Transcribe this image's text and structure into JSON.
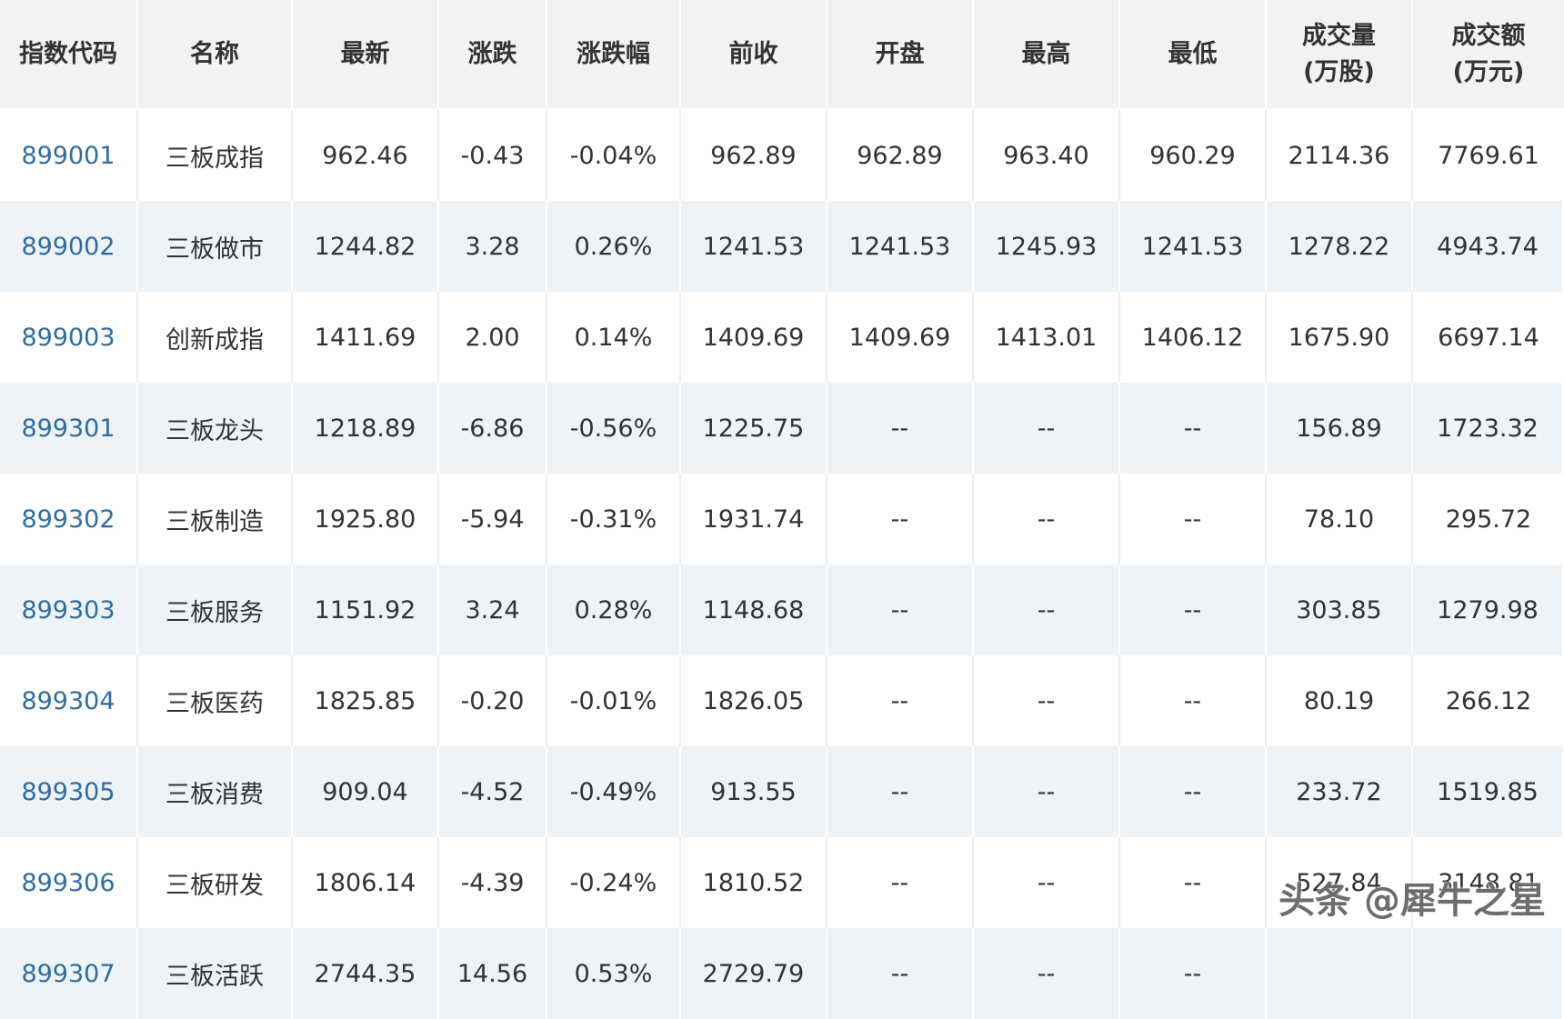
{
  "table": {
    "headers": [
      "指数代码",
      "名称",
      "最新",
      "涨跌",
      "涨跌幅",
      "前收",
      "开盘",
      "最高",
      "最低"
    ],
    "header_volume_line1": "成交量",
    "header_volume_line2": "(万股)",
    "header_amount_line1": "成交额",
    "header_amount_line2": "(万元)",
    "rows": [
      {
        "code": "899001",
        "name": "三板成指",
        "latest": "962.46",
        "change": "-0.43",
        "change_pct": "-0.04%",
        "prev_close": "962.89",
        "open": "962.89",
        "high": "963.40",
        "low": "960.29",
        "volume": "2114.36",
        "amount": "7769.61",
        "direction": "down"
      },
      {
        "code": "899002",
        "name": "三板做市",
        "latest": "1244.82",
        "change": "3.28",
        "change_pct": "0.26%",
        "prev_close": "1241.53",
        "open": "1241.53",
        "high": "1245.93",
        "low": "1241.53",
        "volume": "1278.22",
        "amount": "4943.74",
        "direction": "up"
      },
      {
        "code": "899003",
        "name": "创新成指",
        "latest": "1411.69",
        "change": "2.00",
        "change_pct": "0.14%",
        "prev_close": "1409.69",
        "open": "1409.69",
        "high": "1413.01",
        "low": "1406.12",
        "volume": "1675.90",
        "amount": "6697.14",
        "direction": "up"
      },
      {
        "code": "899301",
        "name": "三板龙头",
        "latest": "1218.89",
        "change": "-6.86",
        "change_pct": "-0.56%",
        "prev_close": "1225.75",
        "open": "--",
        "high": "--",
        "low": "--",
        "volume": "156.89",
        "amount": "1723.32",
        "direction": "down"
      },
      {
        "code": "899302",
        "name": "三板制造",
        "latest": "1925.80",
        "change": "-5.94",
        "change_pct": "-0.31%",
        "prev_close": "1931.74",
        "open": "--",
        "high": "--",
        "low": "--",
        "volume": "78.10",
        "amount": "295.72",
        "direction": "down"
      },
      {
        "code": "899303",
        "name": "三板服务",
        "latest": "1151.92",
        "change": "3.24",
        "change_pct": "0.28%",
        "prev_close": "1148.68",
        "open": "--",
        "high": "--",
        "low": "--",
        "volume": "303.85",
        "amount": "1279.98",
        "direction": "up"
      },
      {
        "code": "899304",
        "name": "三板医药",
        "latest": "1825.85",
        "change": "-0.20",
        "change_pct": "-0.01%",
        "prev_close": "1826.05",
        "open": "--",
        "high": "--",
        "low": "--",
        "volume": "80.19",
        "amount": "266.12",
        "direction": "down"
      },
      {
        "code": "899305",
        "name": "三板消费",
        "latest": "909.04",
        "change": "-4.52",
        "change_pct": "-0.49%",
        "prev_close": "913.55",
        "open": "--",
        "high": "--",
        "low": "--",
        "volume": "233.72",
        "amount": "1519.85",
        "direction": "down"
      },
      {
        "code": "899306",
        "name": "三板研发",
        "latest": "1806.14",
        "change": "-4.39",
        "change_pct": "-0.24%",
        "prev_close": "1810.52",
        "open": "--",
        "high": "--",
        "low": "--",
        "volume": "527.84",
        "amount": "3148.81",
        "direction": "down"
      },
      {
        "code": "899307",
        "name": "三板活跃",
        "latest": "2744.35",
        "change": "14.56",
        "change_pct": "0.53%",
        "prev_close": "2729.79",
        "open": "--",
        "high": "--",
        "low": "--",
        "volume": "",
        "amount": "",
        "direction": "up"
      }
    ]
  },
  "watermark": "头条 @犀牛之星",
  "colors": {
    "up": "#e0161a",
    "down": "#1eb463",
    "link": "#2e6da4",
    "header_bg": "#f2f2f2",
    "stripe_bg": "#eef3f7"
  }
}
